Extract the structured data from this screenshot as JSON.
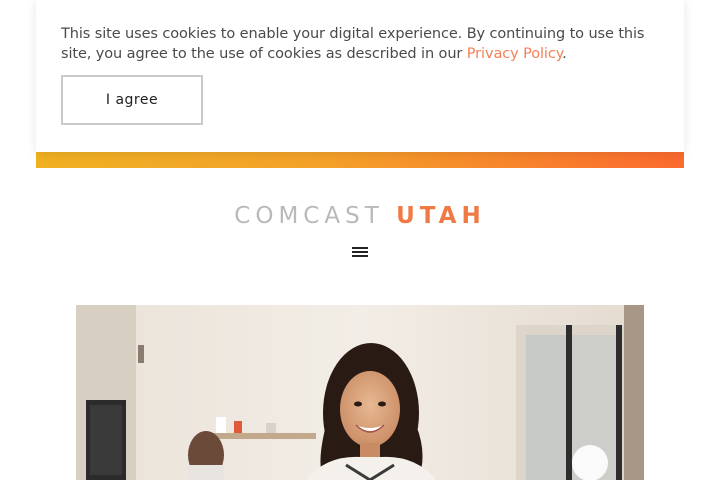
{
  "cookie_banner": {
    "text": "This site uses cookies to enable your digital experience. By continuing to use this site, you agree to the use of cookies as described in our ",
    "link_label": "Privacy Policy",
    "text_end": ".",
    "agree_label": "I agree"
  },
  "header": {
    "brand": "COMCAST",
    "region": "UTAH",
    "menu_icon": "hamburger-menu-icon"
  },
  "hero": {
    "image_name": "hero-photo"
  },
  "colors": {
    "accent": "#f07a45",
    "link": "#f28157",
    "gradient_start": "#f0b123",
    "gradient_end": "#fb6a2f"
  }
}
